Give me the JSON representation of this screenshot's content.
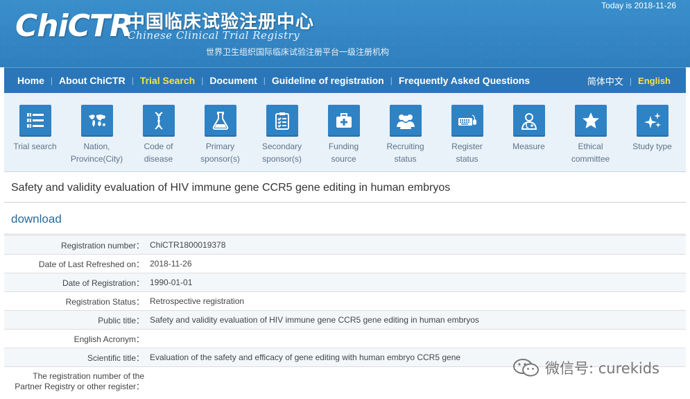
{
  "header": {
    "logo_text": "ChiCTR",
    "title_cn": "中国临床试验注册中心",
    "title_en": "Chinese Clinical Trial Registry",
    "subtitle": "世界卫生组织国际临床试验注册平台一级注册机构",
    "today": "Today is 2018-11-26",
    "accent_color": "#3a8fcb"
  },
  "nav": {
    "items": [
      {
        "label": "Home",
        "active": false
      },
      {
        "label": "About ChiCTR",
        "active": false
      },
      {
        "label": "Trial Search",
        "active": true
      },
      {
        "label": "Document",
        "active": false
      },
      {
        "label": "Guideline of registration",
        "active": false
      },
      {
        "label": "Frequently Asked Questions",
        "active": false
      }
    ],
    "lang_cn": "简体中文",
    "lang_en": "English",
    "active_color": "#f4e542"
  },
  "iconbar": {
    "items": [
      {
        "icon": "list-icon",
        "line1": "Trial search",
        "line2": ""
      },
      {
        "icon": "world-map-icon",
        "line1": "Nation,",
        "line2": "Province(City)"
      },
      {
        "icon": "dna-icon",
        "line1": "Code of",
        "line2": "disease"
      },
      {
        "icon": "flask-icon",
        "line1": "Primary",
        "line2": "sponsor(s)"
      },
      {
        "icon": "clipboard-icon",
        "line1": "Secondary",
        "line2": "sponsor(s)"
      },
      {
        "icon": "medical-kit-icon",
        "line1": "Funding",
        "line2": "source"
      },
      {
        "icon": "people-icon",
        "line1": "Recruiting",
        "line2": "status"
      },
      {
        "icon": "keyboard-mouse-icon",
        "line1": "Register",
        "line2": "status"
      },
      {
        "icon": "doctor-icon",
        "line1": "Measure",
        "line2": ""
      },
      {
        "icon": "star-icon",
        "line1": "Ethical",
        "line2": "committee"
      },
      {
        "icon": "sparkles-icon",
        "line1": "Study type",
        "line2": ""
      }
    ]
  },
  "page": {
    "title": "Safety and validity evaluation of HIV immune gene CCR5 gene editing in human embryos",
    "download": "download"
  },
  "details": {
    "rows": [
      {
        "label": "Registration number：",
        "value": "ChiCTR1800019378"
      },
      {
        "label": "Date of Last Refreshed on：",
        "value": "2018-11-26"
      },
      {
        "label": "Date of Registration：",
        "value": "1990-01-01"
      },
      {
        "label": "Registration Status：",
        "value": "Retrospective registration"
      },
      {
        "label": "Public title：",
        "value": "Safety and validity evaluation of HIV immune gene CCR5 gene editing in human embryos"
      },
      {
        "label": "English Acronym：",
        "value": ""
      },
      {
        "label": "Scientific title：",
        "value": "Evaluation of the safety and efficacy of gene editing with human embryo CCR5 gene"
      }
    ],
    "last_row": {
      "label_line1": "The registration number of the",
      "label_line2": "Partner Registry or other register：",
      "value": ""
    }
  },
  "watermark": {
    "text": "微信号: curekids"
  }
}
